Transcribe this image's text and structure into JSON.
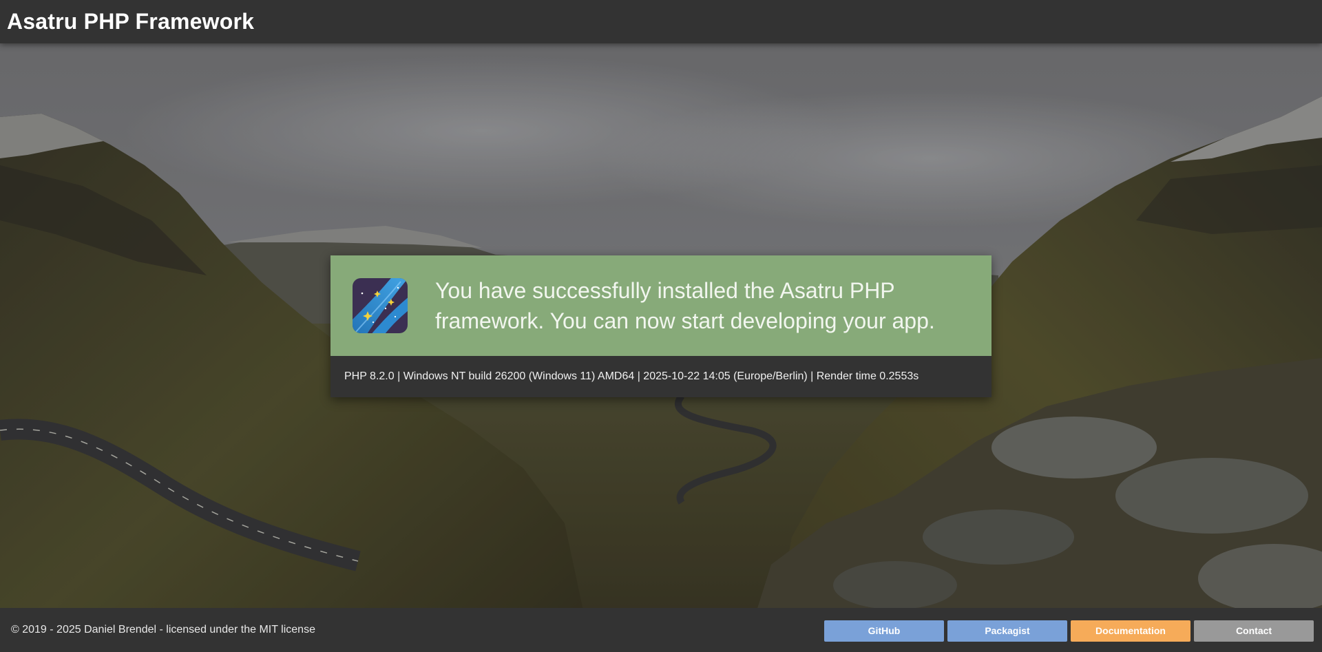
{
  "header": {
    "title": "Asatru PHP Framework"
  },
  "notice": {
    "message": "You have successfully installed the Asatru PHP framework. You can now start developing your app.",
    "system_info": "PHP 8.2.0 | Windows NT build 26200 (Windows 11) AMD64 | 2025-10-22 14:05 (Europe/Berlin) | Render time 0.2553s",
    "logo_icon": "asatru-logo-icon",
    "accent_color": "#87aa79"
  },
  "footer": {
    "copyright": "© 2019 - 2025 Daniel Brendel - licensed under the MIT license",
    "links": {
      "github": "GitHub",
      "packagist": "Packagist",
      "documentation": "Documentation",
      "contact": "Contact"
    },
    "colors": {
      "github": "#7aa1d8",
      "packagist": "#7aa1d8",
      "documentation": "#f6ab59",
      "contact": "#999999"
    }
  }
}
